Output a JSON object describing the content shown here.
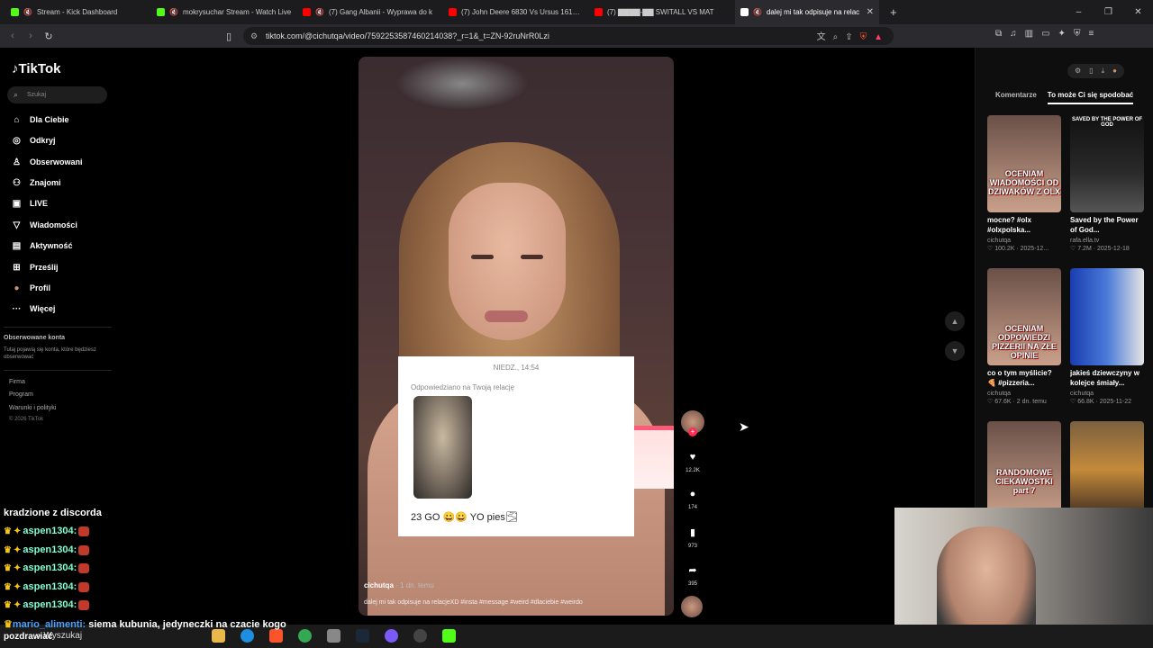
{
  "browser": {
    "tabs": [
      {
        "title": "Stream - Kick Dashboard",
        "color": "#53fc18"
      },
      {
        "title": "mokrysuchar Stream - Watch Live",
        "color": "#53fc18"
      },
      {
        "title": "(7) Gang Albanii - Wyprawa do k",
        "color": "#ff0000"
      },
      {
        "title": "(7) John Deere 6830 Vs Ursus 1614 W",
        "color": "#ff0000"
      },
      {
        "title": "(7) ▇▇▇▇-▇▇ SWITALL VS MAT",
        "color": "#ff0000"
      },
      {
        "title": "dalej mi tak odpisuje na relac",
        "color": "#ffffff"
      }
    ],
    "new_tab": "+",
    "url": "tiktok.com/@cichutqa/video/7592253587460214038?_r=1&_t=ZN-92ruNrR0Lzi",
    "window_controls": [
      "–",
      "❐",
      "✕"
    ]
  },
  "sidebar": {
    "logo": "TikTok",
    "search_placeholder": "Szukaj",
    "items": [
      {
        "label": "Dla Ciebie",
        "icon": "⌂"
      },
      {
        "label": "Odkryj",
        "icon": "◎"
      },
      {
        "label": "Obserwowani",
        "icon": "♙"
      },
      {
        "label": "Znajomi",
        "icon": "⚇"
      },
      {
        "label": "LIVE",
        "icon": "▣"
      },
      {
        "label": "Wiadomości",
        "icon": "▽"
      },
      {
        "label": "Aktywność",
        "icon": "▤"
      },
      {
        "label": "Prześlij",
        "icon": "⊞"
      },
      {
        "label": "Profil",
        "icon": "●"
      },
      {
        "label": "Więcej",
        "icon": "···"
      }
    ],
    "following_header": "Obserwowane konta",
    "following_desc": "Tutaj pojawią się konta, które będziesz obserwować",
    "footer": [
      "Firma",
      "Program",
      "Warunki i polityki"
    ],
    "copyright": "© 2026 TikTok"
  },
  "video": {
    "card_time": "NIEDZ., 14:54",
    "card_subtitle": "Odpowiedziano na Twoją relację",
    "reply_text": "23 GO 😀😀 YO pies🌫",
    "author": "cichutqa",
    "posted": "· 1 dn. temu",
    "description": "dalej mi tak odpisuje na relacjeXD #insta #message #weird #dlaciebie #weirdo",
    "likes": "12.2K",
    "comments": "174",
    "saves": "973",
    "shares": "395"
  },
  "right_panel": {
    "tab_comments": "Komentarze",
    "tab_recommended": "To może Ci się spodobać",
    "videos": [
      {
        "overlay": "OCENIAM WIADOMOŚCI OD DZIWAKÓW Z OLX",
        "caption": "mocne? #olx #olxpolska...",
        "author": "cichutqa",
        "stats": "♡ 100.2K · 2025-12..."
      },
      {
        "overlay": "SAVED BY THE POWER OF GOD",
        "caption": "Saved by the Power of God...",
        "author": "rafa.ella.tv",
        "stats": "♡ 7.2M · 2025-12-18"
      },
      {
        "overlay": "OCENIAM ODPOWIEDZI PIZZERII NA ZŁE OPINIE",
        "caption": "co o tym myślicie? 🍕 #pizzeria...",
        "author": "cichutqa",
        "stats": "♡ 67.6K · 2 dn. temu"
      },
      {
        "overlay": "",
        "caption": "jakieś dziewczyny w kolejce śmiały...",
        "author": "cichutqa",
        "stats": "♡ 66.8K · 2025-11-22"
      },
      {
        "overlay": "RANDOMOWE CIEKAWOSTKI part 7",
        "caption": "",
        "author": "",
        "stats": ""
      },
      {
        "overlay": "",
        "caption": "",
        "author": "",
        "stats": ""
      }
    ]
  },
  "stream_chat": {
    "title": "kradzione z discorda",
    "lines": [
      {
        "user": "aspen1304:"
      },
      {
        "user": "aspen1304:"
      },
      {
        "user": "aspen1304:"
      },
      {
        "user": "aspen1304:"
      },
      {
        "user": "aspen1304:"
      }
    ],
    "last_user": "mario_alimenti:",
    "last_msg": "siema kubunia, jedyneczki na czacie kogo",
    "last_line": "pozdrawiać"
  },
  "taskbar": {
    "search": "Wyszukaj"
  }
}
